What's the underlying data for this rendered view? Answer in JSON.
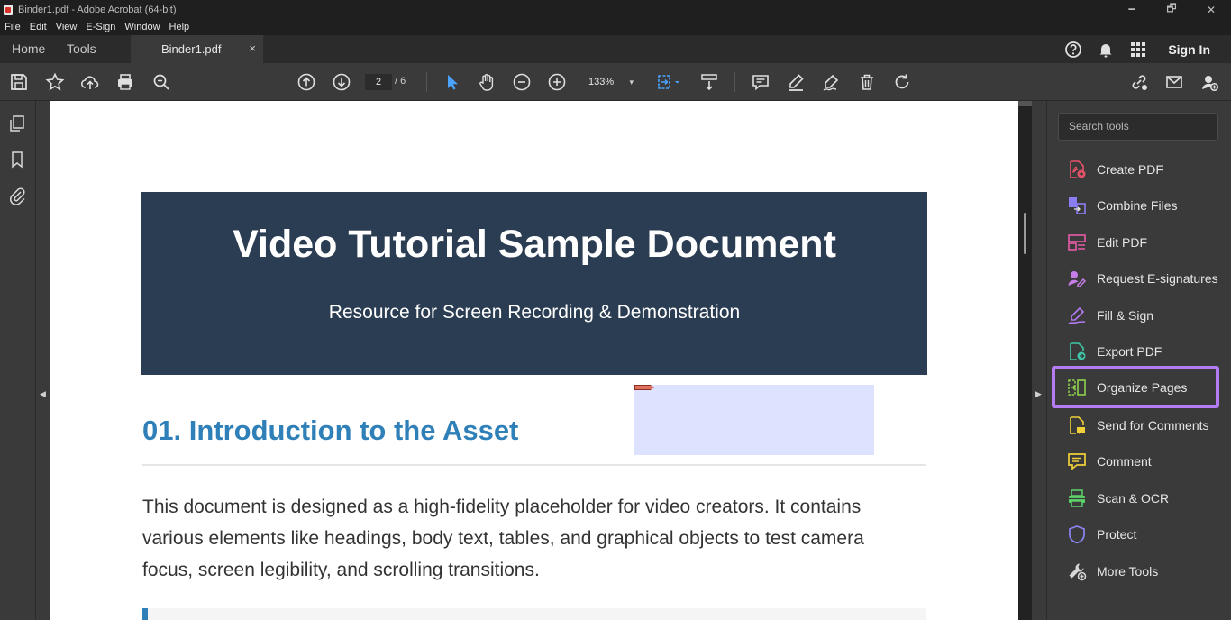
{
  "window": {
    "title": "Binder1.pdf - Adobe Acrobat (64-bit)",
    "minimize": "🗕",
    "maximize": "🗗",
    "close": "✕"
  },
  "menu": [
    "File",
    "Edit",
    "View",
    "E-Sign",
    "Window",
    "Help"
  ],
  "tabs": {
    "home": "Home",
    "tools": "Tools",
    "document": "Binder1.pdf",
    "close": "×",
    "sign_in": "Sign In"
  },
  "toolbar": {
    "page_current": "2",
    "page_total": "/ 6",
    "zoom": "133%",
    "zoom_chevron": "▾"
  },
  "document": {
    "title": "Video Tutorial Sample Document",
    "subtitle": "Resource for Screen Recording & Demonstration",
    "section_title": "01. Introduction to the Asset",
    "paragraph": "This document is designed as a high-fidelity placeholder for video creators. It contains various elements like headings, body text, tables, and graphical objects to test camera focus, screen legibility, and scrolling transitions."
  },
  "panel": {
    "search_placeholder": "Search tools",
    "tools": [
      {
        "label": "Create PDF",
        "icon": "create-pdf-icon",
        "color": "#e8536b"
      },
      {
        "label": "Combine Files",
        "icon": "combine-files-icon",
        "color": "#8a7df2"
      },
      {
        "label": "Edit PDF",
        "icon": "edit-pdf-icon",
        "color": "#e85aa8"
      },
      {
        "label": "Request E-signatures",
        "icon": "request-esign-icon",
        "color": "#c77de8"
      },
      {
        "label": "Fill & Sign",
        "icon": "fill-sign-icon",
        "color": "#b57bf2"
      },
      {
        "label": "Export PDF",
        "icon": "export-pdf-icon",
        "color": "#3fc7a8"
      },
      {
        "label": "Organize Pages",
        "icon": "organize-pages-icon",
        "color": "#8ed14d"
      },
      {
        "label": "Send for Comments",
        "icon": "send-comments-icon",
        "color": "#f0cf38"
      },
      {
        "label": "Comment",
        "icon": "comment-icon",
        "color": "#f0cf38"
      },
      {
        "label": "Scan & OCR",
        "icon": "scan-ocr-icon",
        "color": "#5cd26a"
      },
      {
        "label": "Protect",
        "icon": "protect-icon",
        "color": "#8a86f0"
      },
      {
        "label": "More Tools",
        "icon": "more-tools-icon",
        "color": "#d8d8d8"
      }
    ],
    "selected": "Organize Pages",
    "selected_color": "#b57bf2"
  },
  "colors": {
    "banner": "#2b3d52",
    "heading_blue": "#2f80b8",
    "toolbar_blue": "#4aa3ff"
  }
}
